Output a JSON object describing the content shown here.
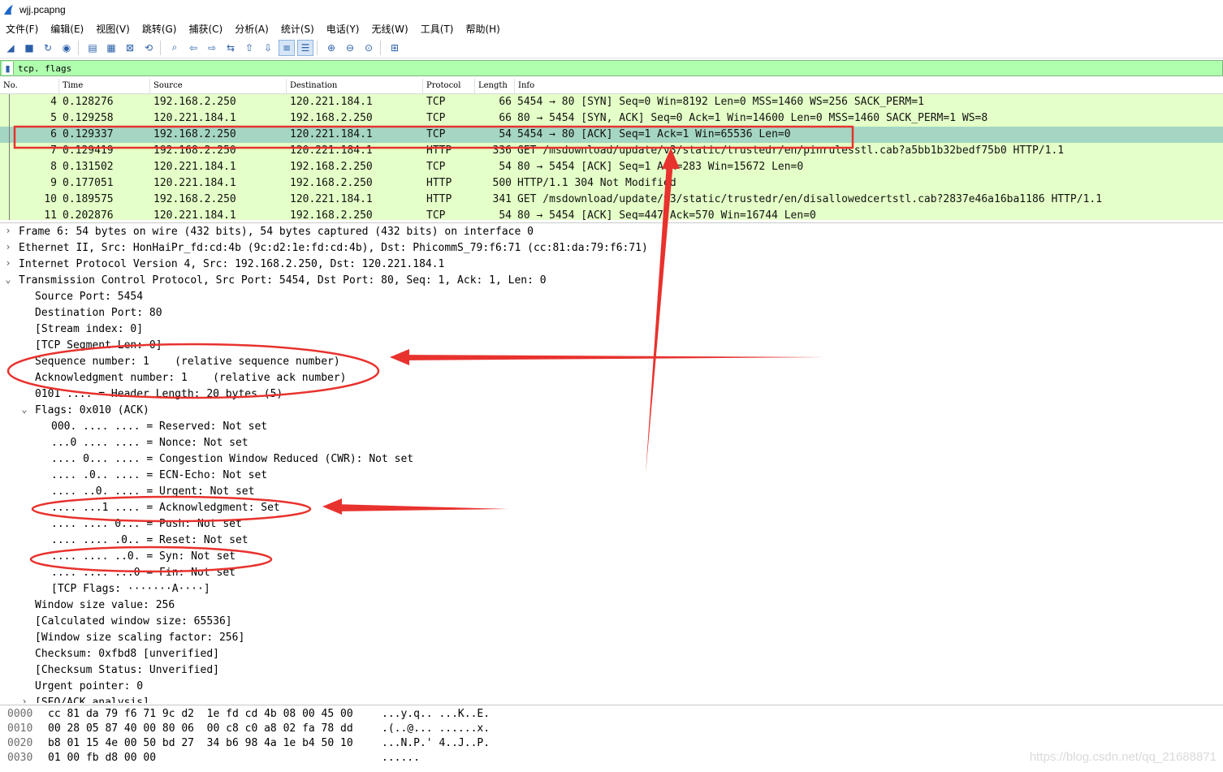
{
  "window": {
    "title": "wjj.pcapng"
  },
  "menu": [
    "文件(F)",
    "编辑(E)",
    "视图(V)",
    "跳转(G)",
    "捕获(C)",
    "分析(A)",
    "统计(S)",
    "电话(Y)",
    "无线(W)",
    "工具(T)",
    "帮助(H)"
  ],
  "toolbar_icons": [
    "shark-fin-start-icon",
    "stop-icon",
    "restart-icon",
    "options-icon",
    "open-file-icon",
    "save-icon",
    "close-file-icon",
    "reload-icon",
    "find-packet-icon",
    "go-back-icon",
    "go-forward-icon",
    "go-to-packet-icon",
    "first-packet-icon",
    "last-packet-icon",
    "autoscroll-icon",
    "colorize-icon",
    "zoom-in-icon",
    "zoom-out-icon",
    "zoom-reset-icon",
    "resize-columns-icon"
  ],
  "filter": {
    "text": "tcp. flags"
  },
  "packet_list": {
    "columns": [
      "No.",
      "Time",
      "Source",
      "Destination",
      "Protocol",
      "Length",
      "Info"
    ],
    "rows": [
      {
        "no": "4",
        "time": "0.128276",
        "src": "192.168.2.250",
        "dst": "120.221.184.1",
        "proto": "TCP",
        "len": "66",
        "info": "5454 → 80 [SYN] Seq=0 Win=8192 Len=0 MSS=1460 WS=256 SACK_PERM=1",
        "selected": false
      },
      {
        "no": "5",
        "time": "0.129258",
        "src": "120.221.184.1",
        "dst": "192.168.2.250",
        "proto": "TCP",
        "len": "66",
        "info": "80 → 5454 [SYN, ACK] Seq=0 Ack=1 Win=14600 Len=0 MSS=1460 SACK_PERM=1 WS=8",
        "selected": false
      },
      {
        "no": "6",
        "time": "0.129337",
        "src": "192.168.2.250",
        "dst": "120.221.184.1",
        "proto": "TCP",
        "len": "54",
        "info": "5454 → 80 [ACK] Seq=1 Ack=1 Win=65536 Len=0",
        "selected": true
      },
      {
        "no": "7",
        "time": "0.129419",
        "src": "192.168.2.250",
        "dst": "120.221.184.1",
        "proto": "HTTP",
        "len": "336",
        "info": "GET /msdownload/update/v3/static/trustedr/en/pinrulesstl.cab?a5bb1b32bedf75b0 HTTP/1.1",
        "selected": false
      },
      {
        "no": "8",
        "time": "0.131502",
        "src": "120.221.184.1",
        "dst": "192.168.2.250",
        "proto": "TCP",
        "len": "54",
        "info": "80 → 5454 [ACK] Seq=1 Ack=283 Win=15672 Len=0",
        "selected": false
      },
      {
        "no": "9",
        "time": "0.177051",
        "src": "120.221.184.1",
        "dst": "192.168.2.250",
        "proto": "HTTP",
        "len": "500",
        "info": "HTTP/1.1 304 Not Modified",
        "selected": false
      },
      {
        "no": "10",
        "time": "0.189575",
        "src": "192.168.2.250",
        "dst": "120.221.184.1",
        "proto": "HTTP",
        "len": "341",
        "info": "GET /msdownload/update/v3/static/trustedr/en/disallowedcertstl.cab?2837e46a16ba1186 HTTP/1.1",
        "selected": false
      },
      {
        "no": "11",
        "time": "0.202876",
        "src": "120.221.184.1",
        "dst": "192.168.2.250",
        "proto": "TCP",
        "len": "54",
        "info": "80 → 5454 [ACK] Seq=447 Ack=570 Win=16744 Len=0",
        "selected": false
      }
    ]
  },
  "details": [
    {
      "indent": 0,
      "twisty": "›",
      "text": "Frame 6: 54 bytes on wire (432 bits), 54 bytes captured (432 bits) on interface 0"
    },
    {
      "indent": 0,
      "twisty": "›",
      "text": "Ethernet II, Src: HonHaiPr_fd:cd:4b (9c:d2:1e:fd:cd:4b), Dst: PhicommS_79:f6:71 (cc:81:da:79:f6:71)"
    },
    {
      "indent": 0,
      "twisty": "›",
      "text": "Internet Protocol Version 4, Src: 192.168.2.250, Dst: 120.221.184.1"
    },
    {
      "indent": 0,
      "twisty": "⌄",
      "text": "Transmission Control Protocol, Src Port: 5454, Dst Port: 80, Seq: 1, Ack: 1, Len: 0"
    },
    {
      "indent": 1,
      "twisty": "",
      "text": "Source Port: 5454"
    },
    {
      "indent": 1,
      "twisty": "",
      "text": "Destination Port: 80"
    },
    {
      "indent": 1,
      "twisty": "",
      "text": "[Stream index: 0]"
    },
    {
      "indent": 1,
      "twisty": "",
      "text": "[TCP Segment Len: 0]"
    },
    {
      "indent": 1,
      "twisty": "",
      "text": "Sequence number: 1    (relative sequence number)"
    },
    {
      "indent": 1,
      "twisty": "",
      "text": "Acknowledgment number: 1    (relative ack number)"
    },
    {
      "indent": 1,
      "twisty": "",
      "text": "0101 .... = Header Length: 20 bytes (5)"
    },
    {
      "indent": 1,
      "twisty": "⌄",
      "text": "Flags: 0x010 (ACK)"
    },
    {
      "indent": 2,
      "twisty": "",
      "text": "000. .... .... = Reserved: Not set"
    },
    {
      "indent": 2,
      "twisty": "",
      "text": "...0 .... .... = Nonce: Not set"
    },
    {
      "indent": 2,
      "twisty": "",
      "text": ".... 0... .... = Congestion Window Reduced (CWR): Not set"
    },
    {
      "indent": 2,
      "twisty": "",
      "text": ".... .0.. .... = ECN-Echo: Not set"
    },
    {
      "indent": 2,
      "twisty": "",
      "text": ".... ..0. .... = Urgent: Not set"
    },
    {
      "indent": 2,
      "twisty": "",
      "text": ".... ...1 .... = Acknowledgment: Set"
    },
    {
      "indent": 2,
      "twisty": "",
      "text": ".... .... 0... = Push: Not set"
    },
    {
      "indent": 2,
      "twisty": "",
      "text": ".... .... .0.. = Reset: Not set"
    },
    {
      "indent": 2,
      "twisty": "",
      "text": ".... .... ..0. = Syn: Not set"
    },
    {
      "indent": 2,
      "twisty": "",
      "text": ".... .... ...0 = Fin: Not set"
    },
    {
      "indent": 2,
      "twisty": "",
      "text": "[TCP Flags: ·······A····]"
    },
    {
      "indent": 1,
      "twisty": "",
      "text": "Window size value: 256"
    },
    {
      "indent": 1,
      "twisty": "",
      "text": "[Calculated window size: 65536]"
    },
    {
      "indent": 1,
      "twisty": "",
      "text": "[Window size scaling factor: 256]"
    },
    {
      "indent": 1,
      "twisty": "",
      "text": "Checksum: 0xfbd8 [unverified]"
    },
    {
      "indent": 1,
      "twisty": "",
      "text": "[Checksum Status: Unverified]"
    },
    {
      "indent": 1,
      "twisty": "",
      "text": "Urgent pointer: 0"
    },
    {
      "indent": 1,
      "twisty": "›",
      "text": "[SEQ/ACK analysis]"
    }
  ],
  "bytes": [
    {
      "offset": "0000",
      "hex": "cc 81 da 79 f6 71 9c d2  1e fd cd 4b 08 00 45 00",
      "ascii": "...y.q.. ...K..E."
    },
    {
      "offset": "0010",
      "hex": "00 28 05 87 40 00 80 06  00 c8 c0 a8 02 fa 78 dd",
      "ascii": ".(..@... ......x."
    },
    {
      "offset": "0020",
      "hex": "b8 01 15 4e 00 50 bd 27  34 b6 98 4a 1e b4 50 10",
      "ascii": "...N.P.' 4..J..P."
    },
    {
      "offset": "0030",
      "hex": "01 00 fb d8 00 00",
      "ascii": "......"
    }
  ],
  "watermark": "https://blog.csdn.net/qq_21688871",
  "colors": {
    "row_bg": "#e4ffc7",
    "row_selected": "#a4d6c3",
    "filter_bg": "#afffaf",
    "annotation": "#e8322e"
  }
}
